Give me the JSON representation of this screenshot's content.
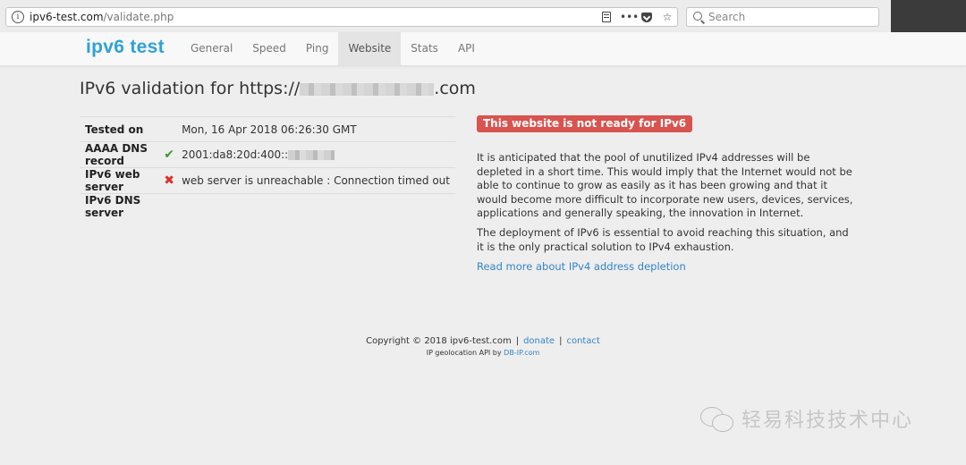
{
  "browser": {
    "url_host": "ipv6-test.com",
    "url_path": "/validate.php",
    "search_placeholder": "Search",
    "more_label": "•••"
  },
  "site": {
    "logo_part1": "ipv6",
    "logo_part2": " ",
    "logo_part3": "test",
    "nav": [
      "General",
      "Speed",
      "Ping",
      "Website",
      "Stats",
      "API"
    ],
    "active_tab": "Website"
  },
  "page": {
    "title_prefix": "IPv6 validation for https://",
    "title_suffix": ".com"
  },
  "results": [
    {
      "label": "Tested on",
      "icon": "",
      "value": "Mon, 16 Apr 2018 06:26:30 GMT"
    },
    {
      "label": "AAAA DNS record",
      "icon": "✔",
      "value": "2001:da8:20d:400::"
    },
    {
      "label": "IPv6 web server",
      "icon": "✖",
      "value": "web server is unreachable : Connection timed out"
    },
    {
      "label": "IPv6 DNS server",
      "icon": "",
      "value": ""
    }
  ],
  "status_badge": "This website is not ready for IPv6",
  "paragraphs": [
    "It is anticipated that the pool of unutilized IPv4 addresses will be depleted in a short time. This would imply that the Internet would not be able to continue to grow as easily as it has been growing and that it would become more difficult to incorporate new users, devices, services, applications and generally speaking, the innovation in Internet.",
    "The deployment of IPv6 is essential to avoid reaching this situation, and it is the only practical solution to IPv4 exhaustion."
  ],
  "read_more": "Read more about IPv4 address depletion",
  "footer": {
    "copyright": "Copyright © 2018 ipv6-test.com",
    "sep": "|",
    "donate": "donate",
    "contact": "contact",
    "geo_prefix": "IP geolocation API by ",
    "geo_link": "DB-IP.com"
  },
  "watermark": "轻易科技技术中心",
  "colors": {
    "badge": "#d9534f",
    "link": "#3385c6",
    "ok": "#3c9a2e",
    "error": "#d9312b"
  }
}
